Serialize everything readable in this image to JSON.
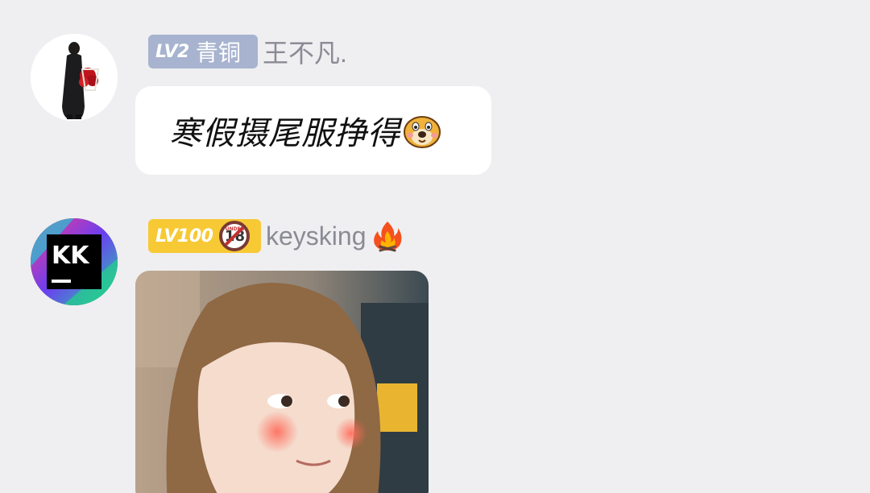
{
  "messages": [
    {
      "level_badge": "LV2",
      "rank": "青铜",
      "username": "王不凡.",
      "text": "寒假摄尾服挣得",
      "emoji": "dog-emoji-icon"
    },
    {
      "level_badge": "LV100",
      "badge_icon": "under-18-icon",
      "under18_small": "UNDER",
      "under18_num": "18",
      "avatar_letters": "KK",
      "username": "keysking",
      "name_icon": "fire-icon",
      "image": "girl-meme-image"
    }
  ],
  "colors": {
    "background": "#efeff1",
    "lv2_badge": "#a7b3cf",
    "lv100_badge": "#f7c934",
    "username": "#8b8b95"
  }
}
